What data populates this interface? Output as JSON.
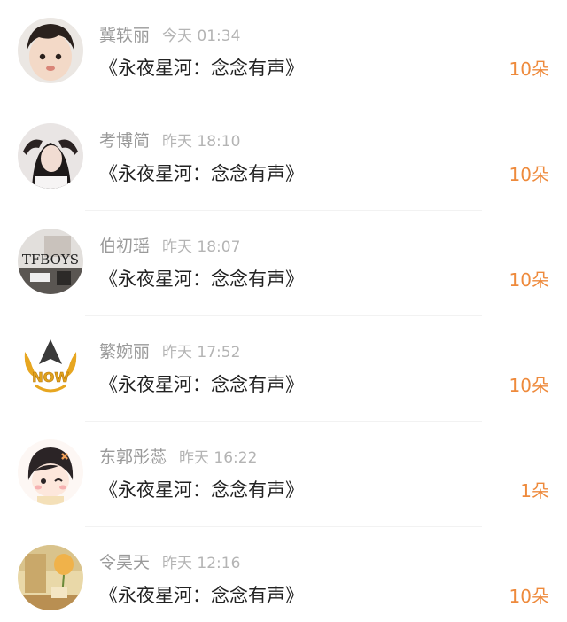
{
  "entries": [
    {
      "name": "冀轶丽",
      "time": "今天 01:34",
      "gift": "《永夜星河：念念有声》",
      "count": "10朵"
    },
    {
      "name": "考博简",
      "time": "昨天 18:10",
      "gift": "《永夜星河：念念有声》",
      "count": "10朵"
    },
    {
      "name": "伯初瑶",
      "time": "昨天 18:07",
      "gift": "《永夜星河：念念有声》",
      "count": "10朵",
      "avatar_text": "TFBOYS"
    },
    {
      "name": "繁婉丽",
      "time": "昨天 17:52",
      "gift": "《永夜星河：念念有声》",
      "count": "10朵",
      "avatar_text": "NOW"
    },
    {
      "name": "东郭彤蕊",
      "time": "昨天 16:22",
      "gift": "《永夜星河：念念有声》",
      "count": "1朵"
    },
    {
      "name": "令昊天",
      "time": "昨天 12:16",
      "gift": "《永夜星河：念念有声》",
      "count": "10朵"
    }
  ],
  "colors": {
    "count": "#ee8a3c",
    "name": "#9a9a9a",
    "time": "#b4b4b4",
    "text": "#222222"
  }
}
